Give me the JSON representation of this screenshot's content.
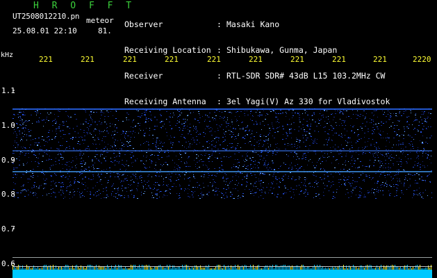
{
  "header": {
    "title": "H R O F F T",
    "filename": "UT2508012210.pn",
    "suffix": "meteor",
    "datetime": "25.08.01 22:10",
    "count": "81."
  },
  "metadata": {
    "labels": [
      "Observer",
      "Receiving Location",
      "Receiver",
      "Receiving Antenna"
    ],
    "colons": [
      ":",
      ":",
      ":",
      ":"
    ],
    "values": [
      "Masaki Kano",
      "Shibukawa, Gunma, Japan",
      "RTL-SDR SDR# 43dB L15 103.2MHz CW",
      "3el Yagi(V) Az 330 for Vladivostok"
    ]
  },
  "axis": {
    "y_unit": "kHz",
    "x_ticks": [
      "221",
      "221",
      "221",
      "221",
      "221",
      "221",
      "221",
      "221",
      "221",
      "2220"
    ],
    "y_ticks": [
      "1.1",
      "1.0",
      "0.9",
      "0.8",
      "0.7",
      "0.6"
    ]
  },
  "colors": {
    "background": "#000000",
    "title": "#3cd23c",
    "tick_labels": "#ffff33",
    "text": "#ffffff",
    "signal": "#1e46ff"
  }
}
